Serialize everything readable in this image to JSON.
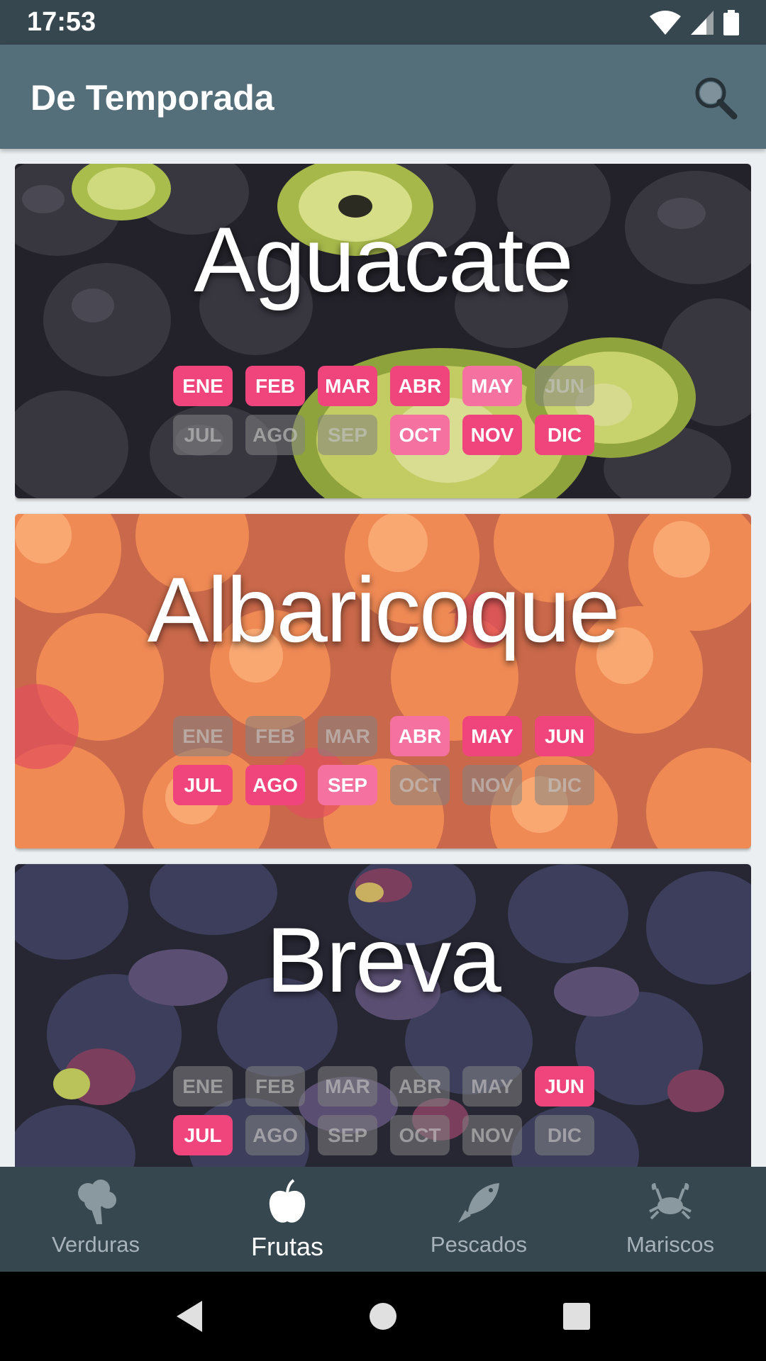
{
  "status_bar": {
    "time": "17:53"
  },
  "app_bar": {
    "title": "De Temporada",
    "search_icon": "search-icon"
  },
  "items": [
    {
      "name": "Aguacate",
      "months": [
        {
          "label": "ENE",
          "state": "full"
        },
        {
          "label": "FEB",
          "state": "full"
        },
        {
          "label": "MAR",
          "state": "full"
        },
        {
          "label": "ABR",
          "state": "full"
        },
        {
          "label": "MAY",
          "state": "part"
        },
        {
          "label": "JUN",
          "state": "off"
        },
        {
          "label": "JUL",
          "state": "off"
        },
        {
          "label": "AGO",
          "state": "off"
        },
        {
          "label": "SEP",
          "state": "off"
        },
        {
          "label": "OCT",
          "state": "part"
        },
        {
          "label": "NOV",
          "state": "full"
        },
        {
          "label": "DIC",
          "state": "full"
        }
      ]
    },
    {
      "name": "Albaricoque",
      "months": [
        {
          "label": "ENE",
          "state": "off"
        },
        {
          "label": "FEB",
          "state": "off"
        },
        {
          "label": "MAR",
          "state": "off"
        },
        {
          "label": "ABR",
          "state": "part"
        },
        {
          "label": "MAY",
          "state": "full"
        },
        {
          "label": "JUN",
          "state": "full"
        },
        {
          "label": "JUL",
          "state": "full"
        },
        {
          "label": "AGO",
          "state": "full"
        },
        {
          "label": "SEP",
          "state": "part"
        },
        {
          "label": "OCT",
          "state": "off"
        },
        {
          "label": "NOV",
          "state": "off"
        },
        {
          "label": "DIC",
          "state": "off"
        }
      ]
    },
    {
      "name": "Breva",
      "months": [
        {
          "label": "ENE",
          "state": "off"
        },
        {
          "label": "FEB",
          "state": "off"
        },
        {
          "label": "MAR",
          "state": "off"
        },
        {
          "label": "ABR",
          "state": "off"
        },
        {
          "label": "MAY",
          "state": "off"
        },
        {
          "label": "JUN",
          "state": "full"
        },
        {
          "label": "JUL",
          "state": "full"
        },
        {
          "label": "AGO",
          "state": "off"
        },
        {
          "label": "SEP",
          "state": "off"
        },
        {
          "label": "OCT",
          "state": "off"
        },
        {
          "label": "NOV",
          "state": "off"
        },
        {
          "label": "DIC",
          "state": "off"
        }
      ]
    }
  ],
  "bottom_nav": [
    {
      "label": "Verduras",
      "icon": "broccoli-icon",
      "active": false
    },
    {
      "label": "Frutas",
      "icon": "apple-icon",
      "active": true
    },
    {
      "label": "Pescados",
      "icon": "fish-icon",
      "active": false
    },
    {
      "label": "Mariscos",
      "icon": "crab-icon",
      "active": false
    }
  ],
  "colors": {
    "status_bar": "#37474f",
    "app_bar": "#546e7a",
    "month_full": "#f0457c",
    "month_part": "#f471a0"
  }
}
